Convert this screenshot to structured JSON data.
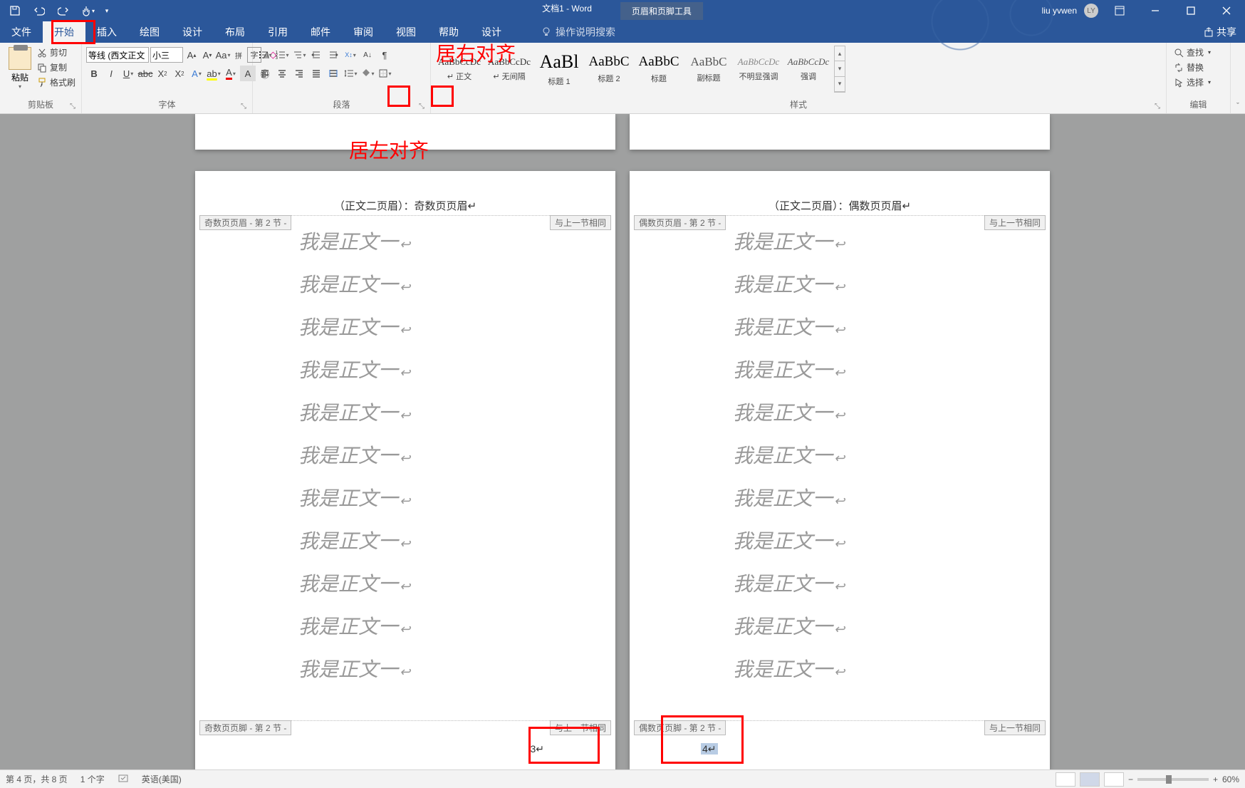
{
  "titlebar": {
    "doc_title": "文档1 - Word",
    "context_tab": "页眉和页脚工具",
    "user": "liu yvwen",
    "avatar": "LY"
  },
  "tabs": {
    "file": "文件",
    "home": "开始",
    "insert": "插入",
    "draw": "绘图",
    "design": "设计",
    "layout": "布局",
    "references": "引用",
    "mailings": "邮件",
    "review": "审阅",
    "view": "视图",
    "help": "帮助",
    "hf_design": "设计",
    "search_placeholder": "操作说明搜索",
    "share": "共享"
  },
  "ribbon": {
    "clipboard": {
      "label": "剪贴板",
      "paste": "粘贴",
      "cut": "剪切",
      "copy": "复制",
      "format_painter": "格式刷"
    },
    "font": {
      "label": "字体",
      "font_name": "等线 (西文正文",
      "font_size": "小三"
    },
    "paragraph": {
      "label": "段落"
    },
    "styles": {
      "label": "样式",
      "items": [
        {
          "preview": "AaBbCcDc",
          "name": "↵ 正文",
          "size": "13px",
          "color": "#333"
        },
        {
          "preview": "AaBbCcDc",
          "name": "↵ 无间隔",
          "size": "13px",
          "color": "#333"
        },
        {
          "preview": "AaBl",
          "name": "标题 1",
          "size": "26px",
          "color": "#000"
        },
        {
          "preview": "AaBbC",
          "name": "标题 2",
          "size": "19px",
          "color": "#000"
        },
        {
          "preview": "AaBbC",
          "name": "标题",
          "size": "19px",
          "color": "#000"
        },
        {
          "preview": "AaBbC",
          "name": "副标题",
          "size": "17px",
          "color": "#555"
        },
        {
          "preview": "AaBbCcDc",
          "name": "不明显强调",
          "size": "13px",
          "color": "#888",
          "italic": true
        },
        {
          "preview": "AaBbCcDc",
          "name": "强调",
          "size": "13px",
          "color": "#555",
          "italic": true
        }
      ]
    },
    "editing": {
      "label": "编辑",
      "find": "查找",
      "replace": "替换",
      "select": "选择"
    }
  },
  "annotations": {
    "right_align": "居右对齐",
    "left_align": "居左对齐"
  },
  "doc": {
    "odd_header_text": "（正文二页眉）：奇数页页眉↵",
    "even_header_text": "（正文二页眉）：偶数页页眉↵",
    "odd_header_tag": "奇数页页眉 - 第 2 节 -",
    "even_header_tag": "偶数页页眉 - 第 2 节 -",
    "odd_footer_tag": "奇数页页脚 - 第 2 节 -",
    "even_footer_tag": "偶数页页脚 - 第 2 节 -",
    "same_as_prev": "与上一节相同",
    "body_line": "我是正文一",
    "page_num_odd": "3↵",
    "page_num_even": "4↵"
  },
  "statusbar": {
    "page": "第 4 页，共 8 页",
    "words": "1 个字",
    "lang": "英语(美国)",
    "zoom": "60%"
  }
}
